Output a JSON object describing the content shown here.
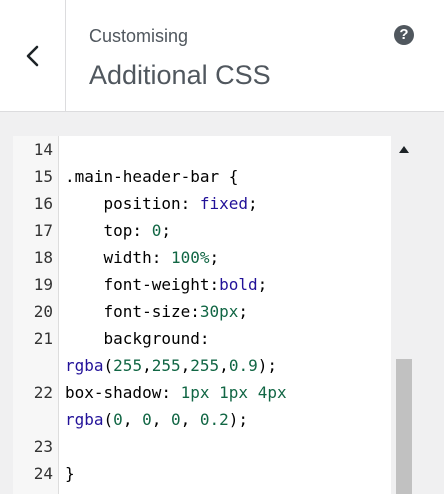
{
  "header": {
    "subtitle": "Customising",
    "title": "Additional CSS",
    "help_symbol": "?"
  },
  "icons": {
    "back": "chevron-left-icon",
    "help": "help-icon",
    "scroll_up": "arrow-up-icon"
  },
  "colors": {
    "value_keyword": "#221199",
    "number": "#116644",
    "scroll_thumb": "#c1c1c1",
    "panel_bg": "#f0f0f1"
  },
  "editor": {
    "lines": [
      {
        "num": "14",
        "tokens": []
      },
      {
        "num": "15",
        "tokens": [
          {
            "t": ".main-header-bar {",
            "c": "plain"
          }
        ]
      },
      {
        "num": "16",
        "tokens": [
          {
            "t": "    position: ",
            "c": "property"
          },
          {
            "t": "fixed",
            "c": "value"
          },
          {
            "t": ";",
            "c": "plain"
          }
        ]
      },
      {
        "num": "17",
        "tokens": [
          {
            "t": "    top: ",
            "c": "property"
          },
          {
            "t": "0",
            "c": "number"
          },
          {
            "t": ";",
            "c": "plain"
          }
        ]
      },
      {
        "num": "18",
        "tokens": [
          {
            "t": "    width: ",
            "c": "property"
          },
          {
            "t": "100%",
            "c": "number"
          },
          {
            "t": ";",
            "c": "plain"
          }
        ]
      },
      {
        "num": "19",
        "tokens": [
          {
            "t": "    font-weight:",
            "c": "property"
          },
          {
            "t": "bold",
            "c": "value"
          },
          {
            "t": ";",
            "c": "plain"
          }
        ]
      },
      {
        "num": "20",
        "tokens": [
          {
            "t": "    font-size:",
            "c": "property"
          },
          {
            "t": "30px",
            "c": "number"
          },
          {
            "t": ";",
            "c": "plain"
          }
        ]
      },
      {
        "num": "21",
        "tokens": [
          {
            "t": "    background:",
            "c": "property"
          }
        ]
      },
      {
        "num": "",
        "tokens": [
          {
            "t": "rgba",
            "c": "func"
          },
          {
            "t": "(",
            "c": "plain"
          },
          {
            "t": "255",
            "c": "number"
          },
          {
            "t": ",",
            "c": "plain"
          },
          {
            "t": "255",
            "c": "number"
          },
          {
            "t": ",",
            "c": "plain"
          },
          {
            "t": "255",
            "c": "number"
          },
          {
            "t": ",",
            "c": "plain"
          },
          {
            "t": "0.9",
            "c": "number"
          },
          {
            "t": ");",
            "c": "plain"
          }
        ]
      },
      {
        "num": "22",
        "tokens": [
          {
            "t": "box-shadow: ",
            "c": "property"
          },
          {
            "t": "1px",
            "c": "number"
          },
          {
            "t": " ",
            "c": "plain"
          },
          {
            "t": "1px",
            "c": "number"
          },
          {
            "t": " ",
            "c": "plain"
          },
          {
            "t": "4px",
            "c": "number"
          }
        ]
      },
      {
        "num": "",
        "tokens": [
          {
            "t": "rgba",
            "c": "func"
          },
          {
            "t": "(",
            "c": "plain"
          },
          {
            "t": "0",
            "c": "number"
          },
          {
            "t": ", ",
            "c": "plain"
          },
          {
            "t": "0",
            "c": "number"
          },
          {
            "t": ", ",
            "c": "plain"
          },
          {
            "t": "0",
            "c": "number"
          },
          {
            "t": ", ",
            "c": "plain"
          },
          {
            "t": "0.2",
            "c": "number"
          },
          {
            "t": ");",
            "c": "plain"
          }
        ]
      },
      {
        "num": "23",
        "tokens": []
      },
      {
        "num": "24",
        "tokens": [
          {
            "t": "}",
            "c": "plain"
          }
        ]
      }
    ]
  }
}
